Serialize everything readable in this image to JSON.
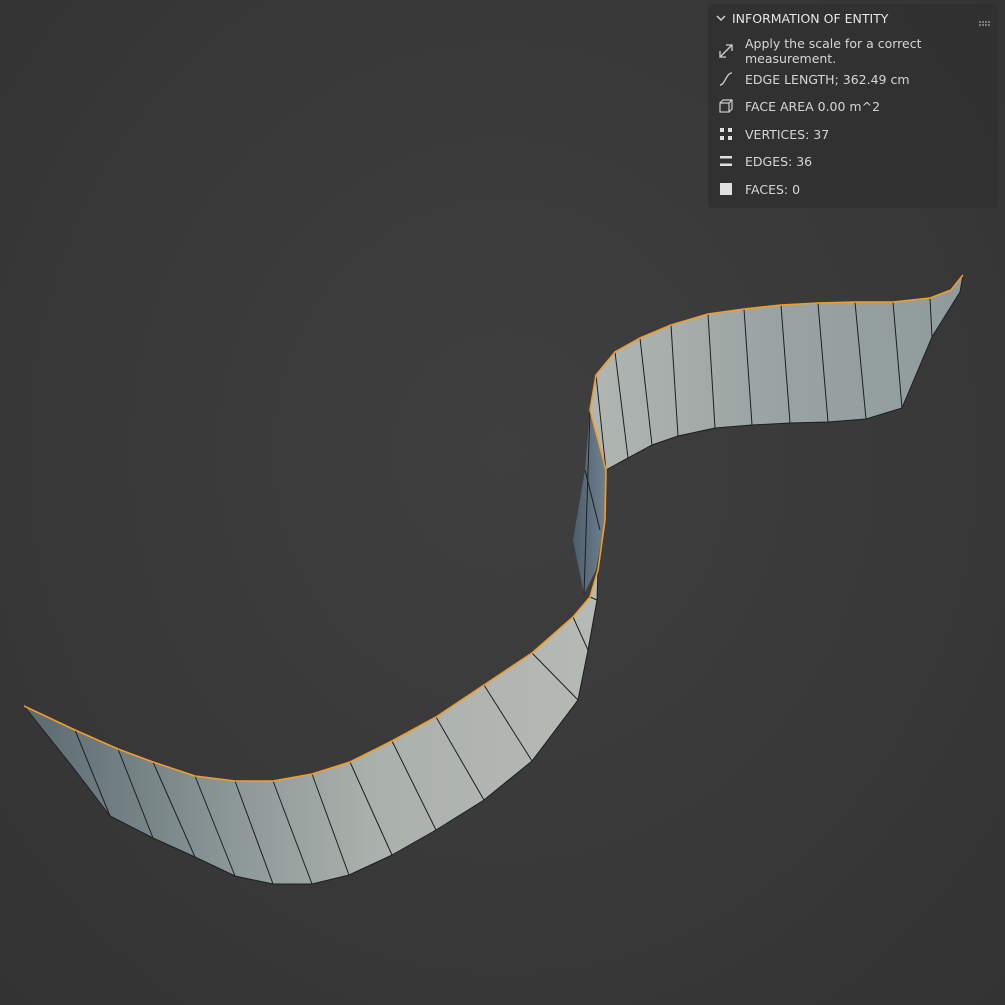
{
  "panel": {
    "title": "INFORMATION OF ENTITY",
    "rows": [
      {
        "icon": "scale-arrows-icon",
        "text": "Apply the scale for a correct measurement."
      },
      {
        "icon": "curve-icon",
        "text": "EDGE LENGTH; 362.49 cm"
      },
      {
        "icon": "cube-icon",
        "text": "FACE AREA 0.00 m^2"
      },
      {
        "icon": "vertices-icon",
        "text": "VERTICES: 37"
      },
      {
        "icon": "edges-icon",
        "text": "EDGES: 36"
      },
      {
        "icon": "faces-icon",
        "text": "FACES: 0"
      }
    ]
  },
  "colors": {
    "viewport_background": "#3a3a3a",
    "selection_edge": "#f39c2a",
    "mesh_light": "#aeb3ae",
    "mesh_dark": "#536068"
  }
}
